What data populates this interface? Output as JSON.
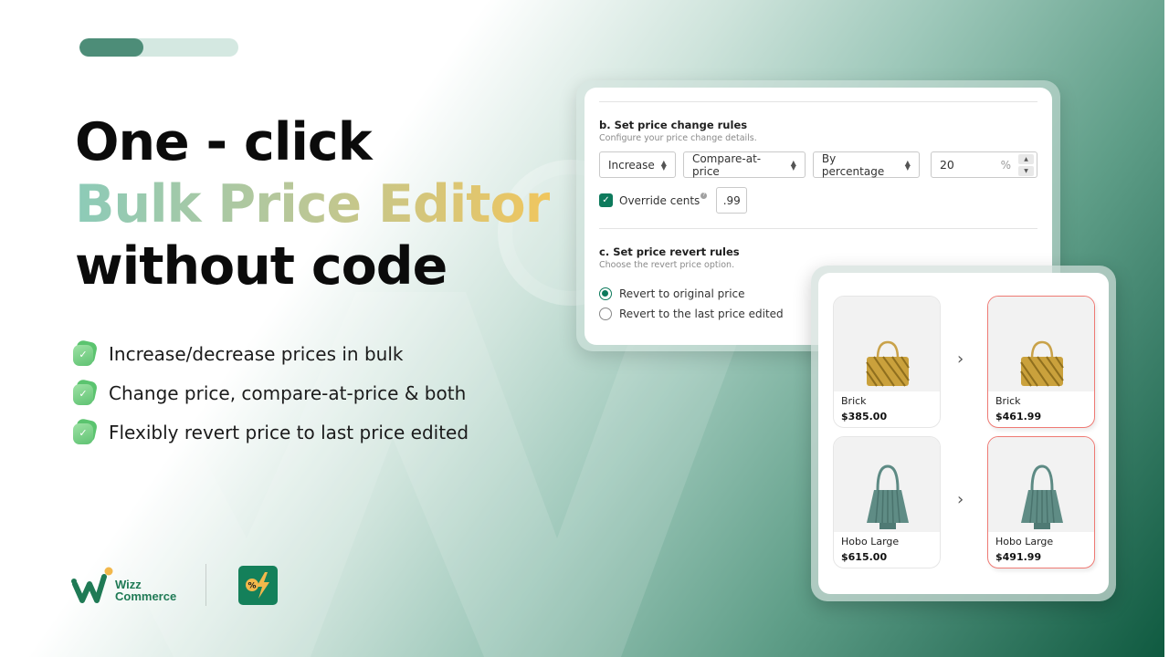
{
  "progress": {
    "value_percent": 40
  },
  "headline": {
    "line1": "One - click",
    "line2": "Bulk Price Editor",
    "line3": "without code"
  },
  "features": [
    {
      "icon": "check-badge-icon",
      "text": "Increase/decrease prices in bulk"
    },
    {
      "icon": "check-badge-icon",
      "text": "Change price, compare-at-price & both"
    },
    {
      "icon": "check-badge-icon",
      "text": "Flexibly revert price to last price edited"
    }
  ],
  "brand": {
    "name_line1": "Wizz",
    "name_line2": "Commerce",
    "app_icon": "percent-lightning-icon",
    "app_icon_glyph": "%",
    "colors": {
      "primary": "#14805a",
      "accent": "#f2b84b"
    }
  },
  "settings": {
    "price_change": {
      "title": "b. Set price change rules",
      "subtitle": "Configure your price change details.",
      "direction": "Increase",
      "target": "Compare-at-price",
      "method": "By percentage",
      "amount": "20",
      "unit": "%",
      "override_cents_label": "Override cents",
      "override_cents_checked": true,
      "cents_value": ".99"
    },
    "revert": {
      "title": "c. Set price revert rules",
      "subtitle": "Choose the revert price option.",
      "options": [
        {
          "label": "Revert to original price",
          "selected": true
        },
        {
          "label": "Revert to the last price edited",
          "selected": false
        }
      ]
    }
  },
  "products": [
    {
      "before": {
        "name": "Brick",
        "price": "$385.00"
      },
      "after": {
        "name": "Brick",
        "price": "$461.99"
      }
    },
    {
      "before": {
        "name": "Hobo Large",
        "price": "$615.00"
      },
      "after": {
        "name": "Hobo Large",
        "price": "$491.99"
      }
    }
  ],
  "glyphs": {
    "chevron": "›",
    "check": "✓",
    "select_arrows_up": "▲",
    "select_arrows_down": "▼",
    "help": "?"
  },
  "colors": {
    "accent_green": "#0d7a5c",
    "changed_border": "#ef7a74"
  }
}
